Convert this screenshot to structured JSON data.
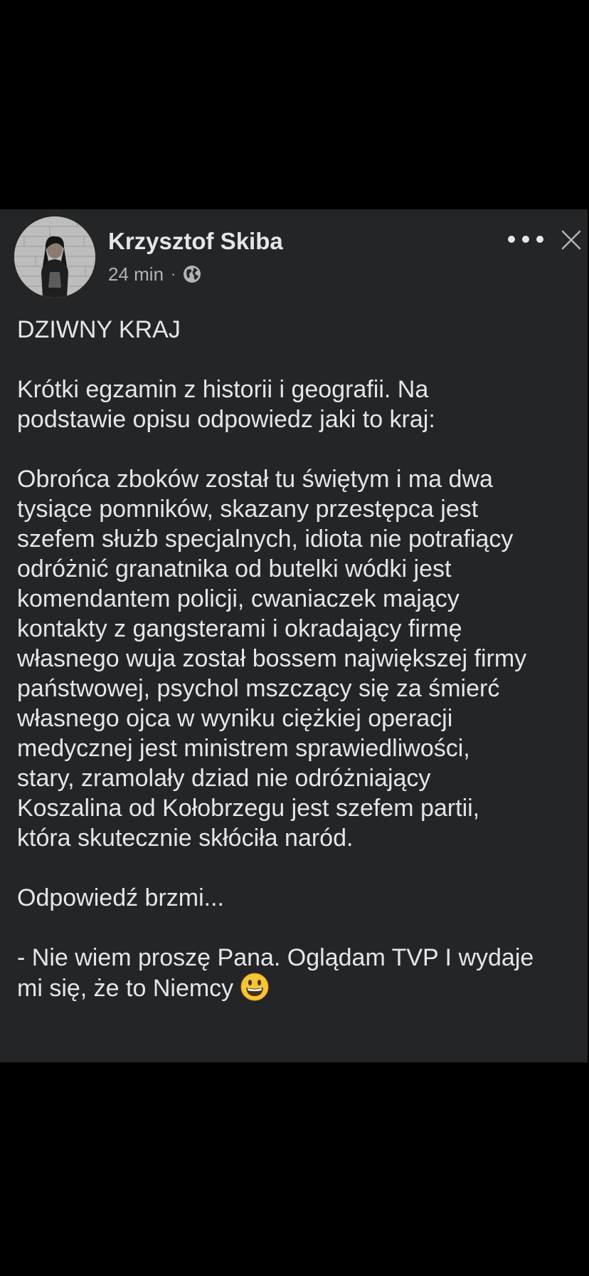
{
  "post": {
    "author": "Krzysztof Skiba",
    "timestamp": "24 min",
    "separator": "·",
    "audience_icon": "globe-icon",
    "menu_icon": "more-options-icon",
    "close_icon": "close-icon",
    "title": "DZIWNY KRAJ",
    "intro_lines": [
      "Krótki egzamin z historii i geografii. Na",
      "podstawie opisu odpowiedz jaki to kraj:"
    ],
    "body_lines": [
      "Obrońca zboków został  tu świętym i ma dwa",
      "tysiące pomników, skazany przestępca jest",
      "szefem służb specjalnych, idiota nie potrafiący",
      "odróżnić granatnika od butelki wódki jest",
      "komendantem policji, cwaniaczek mający",
      "kontakty z gangsterami i okradający firmę",
      "własnego wuja został bossem największej firmy",
      "państwowej, psychol mszczący się za śmierć",
      "własnego ojca w wyniku ciężkiej operacji",
      "medycznej jest ministrem sprawiedliwości,",
      "stary, zramolały dziad nie odróżniający",
      "Koszalina od Kołobrzegu jest szefem partii,",
      "która skutecznie skłóciła naród."
    ],
    "answer_label": "Odpowiedź brzmi...",
    "answer_lines": [
      "- Nie wiem proszę Pana. Oglądam TVP I wydaje",
      "mi się, że to Niemcy"
    ],
    "emoji_icon": "grinning-face-emoji"
  }
}
